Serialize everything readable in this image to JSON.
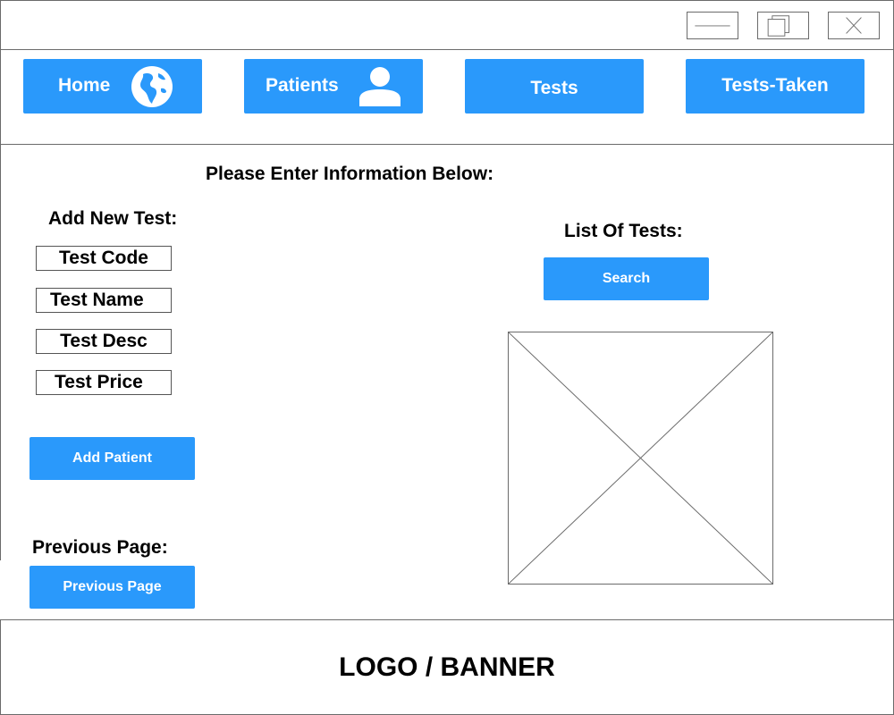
{
  "window": {
    "minimize_icon": "minimize-icon",
    "restore_icon": "restore-icon",
    "close_icon": "close-icon"
  },
  "nav": {
    "home_label": "Home",
    "home_icon": "globe-icon",
    "patients_label": "Patients",
    "patients_icon": "user-icon",
    "tests_label": "Tests",
    "tests_taken_label": "Tests-Taken"
  },
  "main": {
    "instruction": "Please Enter Information Below:",
    "add_new_test_heading": "Add New Test:",
    "fields": {
      "test_code": "Test Code",
      "test_name": "Test Name",
      "test_desc": "Test Desc",
      "test_price": "Test Price"
    },
    "add_button_label": "Add Patient",
    "previous_page_heading": "Previous Page:",
    "previous_page_button_label": "Previous Page",
    "list_heading": "List Of Tests:",
    "search_button_label": "Search",
    "list_placeholder_icon": "image-placeholder-icon"
  },
  "footer": {
    "banner": "LOGO / BANNER"
  },
  "colors": {
    "accent": "#2a99fb",
    "border": "#6b6b6b",
    "text": "#000000"
  }
}
